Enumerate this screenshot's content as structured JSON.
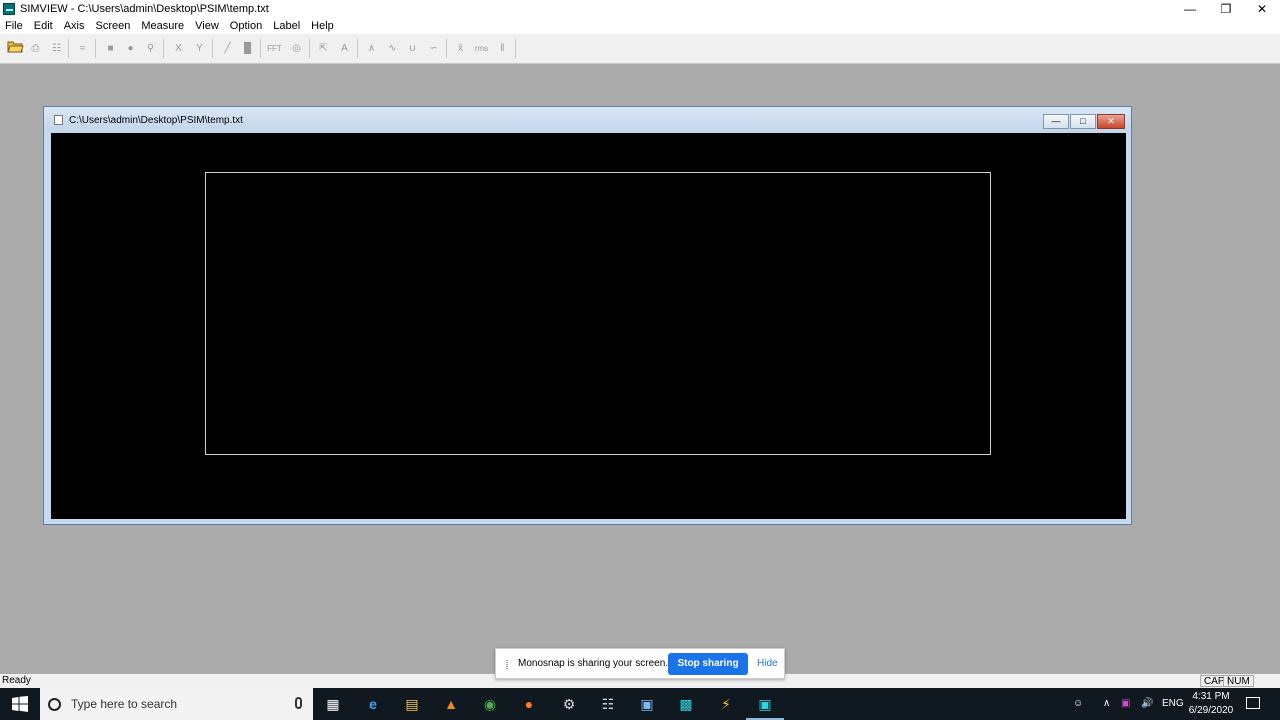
{
  "window": {
    "title": "SIMVIEW - C:\\Users\\admin\\Desktop\\PSIM\\temp.txt",
    "icon": "simview-app-icon",
    "minimize": "—",
    "restore": "❐",
    "close": "✕"
  },
  "menu": [
    "File",
    "Edit",
    "Axis",
    "Screen",
    "Measure",
    "View",
    "Option",
    "Label",
    "Help"
  ],
  "toolbar": {
    "x_label": "X",
    "y_label": "Y",
    "fft_label": "FFT",
    "text_label": "A",
    "rms_label": "rms"
  },
  "child": {
    "title": "C:\\Users\\admin\\Desktop\\PSIM\\temp.txt",
    "minimize": "—",
    "restore": "□",
    "close": "✕"
  },
  "status": {
    "text": "Ready",
    "cap": "CAP",
    "num": "NUM"
  },
  "share": {
    "message": "Monosnap is sharing your screen.",
    "stop": "Stop sharing",
    "hide": "Hide"
  },
  "taskbar": {
    "search_placeholder": "Type here to search",
    "lang": "ENG",
    "time": "4:31 PM",
    "date": "6/29/2020"
  },
  "colors": {
    "mdi_bg": "#ababab",
    "plot_bg": "#000000",
    "accent": "#1a73e8"
  }
}
